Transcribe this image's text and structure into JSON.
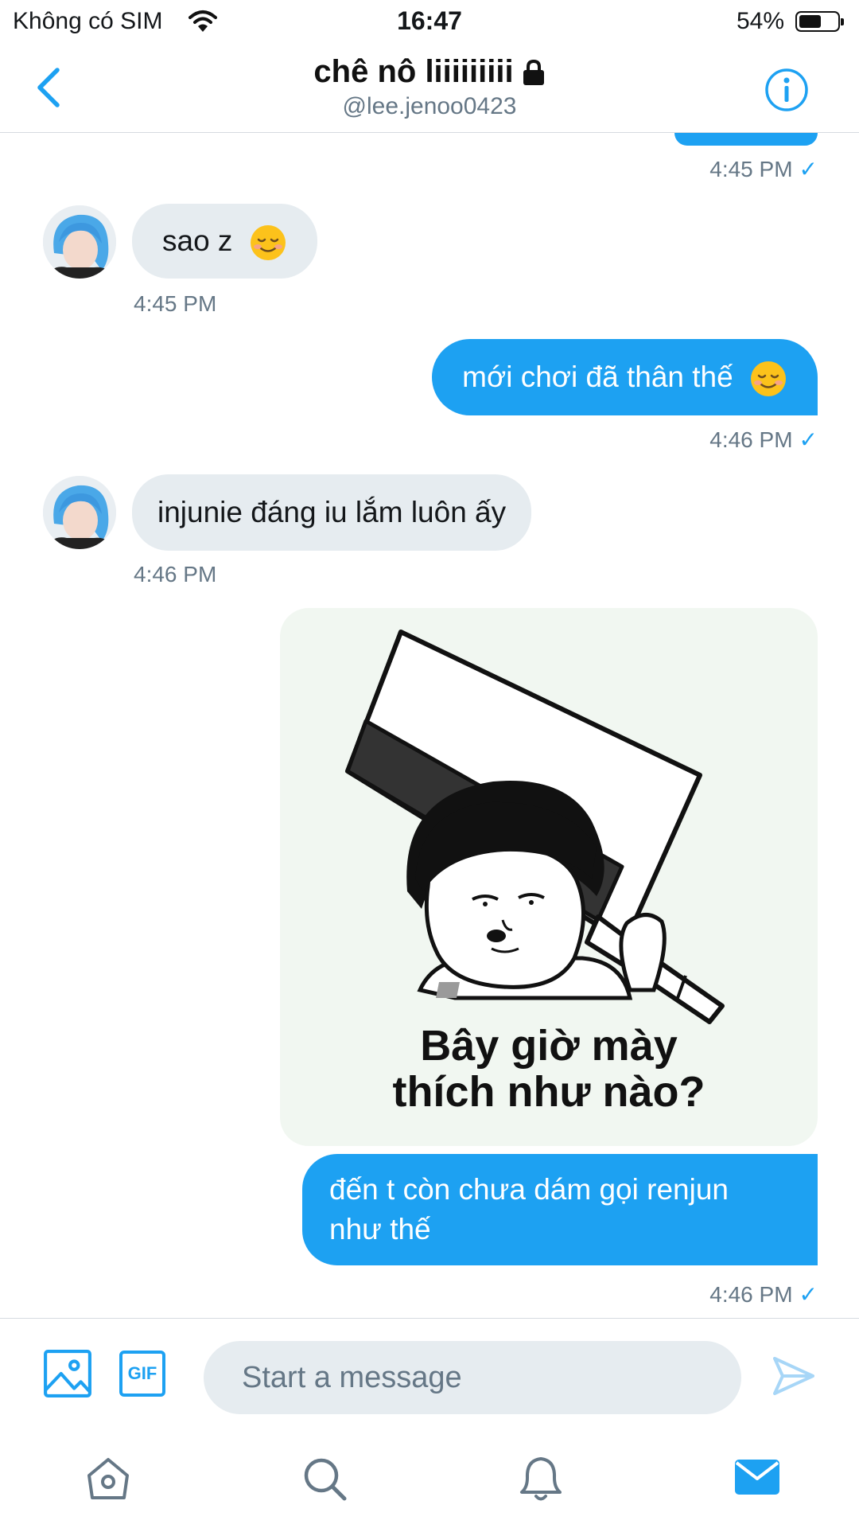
{
  "status_bar": {
    "carrier": "Không có SIM",
    "time": "16:47",
    "battery": "54%"
  },
  "header": {
    "title": "chê nô liiiiiiiii",
    "handle": "@lee.jenoo0423"
  },
  "messages": [
    {
      "time": "4:45 PM",
      "check": "✓"
    },
    {
      "text": "sao z",
      "emoji": "relieved-smile",
      "time": "4:45 PM"
    },
    {
      "text": "mới chơi đã thân thế",
      "emoji": "relieved-smile",
      "time": "4:46 PM",
      "check": "✓"
    },
    {
      "text": "injunie đáng iu lắm luôn ấy",
      "time": "4:46 PM"
    },
    {
      "sticker_caption": [
        "Bây giờ mày",
        "thích như nào?"
      ]
    },
    {
      "text_lines": [
        "đến t còn chưa dám gọi renjun",
        "như thế"
      ],
      "time": "4:46 PM",
      "check": "✓"
    }
  ],
  "composer": {
    "placeholder": "Start a message",
    "gif_label": "GIF"
  },
  "colors": {
    "accent": "#1da1f2",
    "incoming_bubble": "#e6ecf0",
    "muted_text": "#657786"
  }
}
